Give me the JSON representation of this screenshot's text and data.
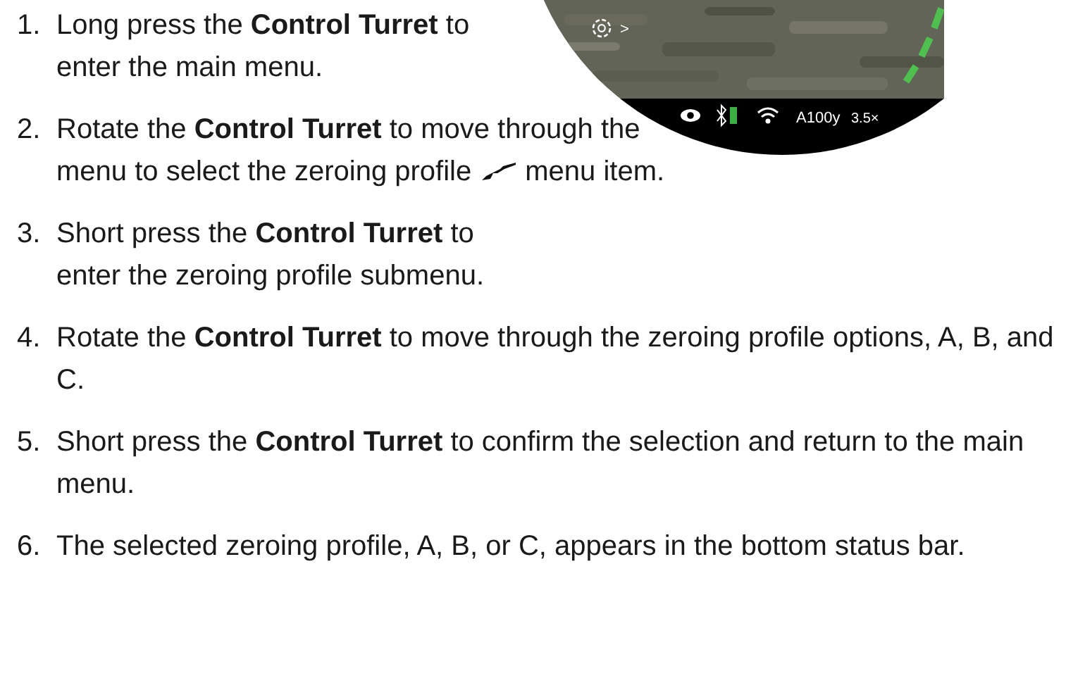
{
  "scope": {
    "menu_arrow": ">",
    "profile_distance": "A100y",
    "magnification": "3.5×"
  },
  "steps": [
    {
      "number": "1.",
      "text": "Long press the **Control Turret** to enter the main menu."
    },
    {
      "number": "2.",
      "text": "Rotate the **Control Turret** to move through the",
      "text_2": "menu to select the zeroing profile",
      "after_icon": "menu item."
    },
    {
      "number": "3.",
      "text": "Short press the **Control Turret** to enter the zeroing profile submenu."
    },
    {
      "number": "4.",
      "text": "Rotate the **Control Turret** to move through the zeroing profile options, A, B, and C."
    },
    {
      "number": "5.",
      "text": "Short press the **Control Turret** to confirm the selection and return to the main menu."
    },
    {
      "number": "6.",
      "text": "The selected zeroing profile, A, B, or C, appears in the bottom status bar."
    }
  ]
}
